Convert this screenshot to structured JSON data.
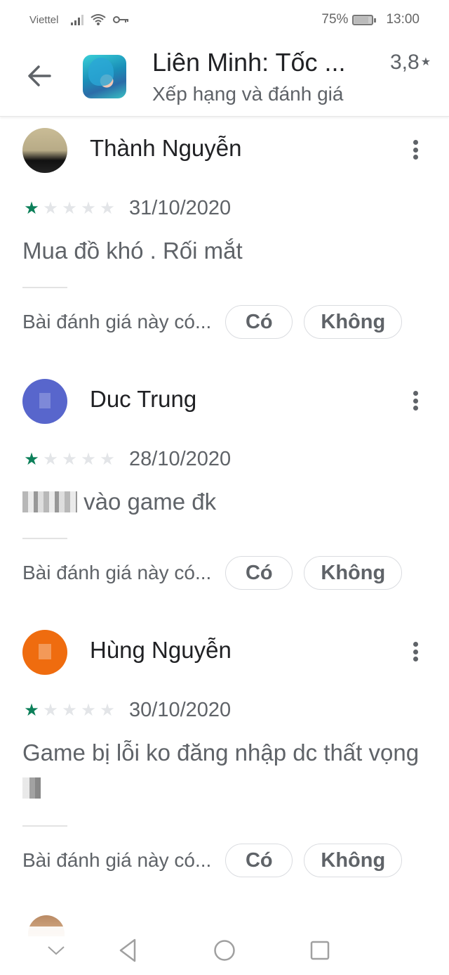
{
  "status_bar": {
    "carrier": "Viettel",
    "battery_percent": "75%",
    "battery_level": 0.75,
    "time": "13:00",
    "icons": [
      "signal-icon",
      "wifi-icon",
      "vpn-key-icon",
      "battery-saver-icon"
    ]
  },
  "app_bar": {
    "back_icon": "arrow-left-icon",
    "app_icon": "app-icon-lien-minh",
    "title": "Liên Minh: Tốc ...",
    "subtitle": "Xếp hạng và đánh giá",
    "rating": "3,8",
    "rating_star": "★"
  },
  "reviews": [
    {
      "name": "Thành Nguyễn",
      "rating": 1,
      "max_rating": 5,
      "date": "31/10/2020",
      "text": "Mua đồ khó . Rối mắt",
      "helpful_label": "Bài đánh giá này có...",
      "yes_label": "Có",
      "no_label": "Không"
    },
    {
      "name": "Duc Trung",
      "rating": 1,
      "max_rating": 5,
      "date": "28/10/2020",
      "text_censored_prefix": true,
      "text": " vào game đk",
      "helpful_label": "Bài đánh giá này có...",
      "yes_label": "Có",
      "no_label": "Không"
    },
    {
      "name": "Hùng Nguyễn",
      "rating": 1,
      "max_rating": 5,
      "date": "30/10/2020",
      "text": "Game bị lỗi ko đăng nhập dc thất vọng ",
      "text_censored_suffix": true,
      "helpful_label": "Bài đánh giá này có...",
      "yes_label": "Có",
      "no_label": "Không"
    }
  ],
  "colors": {
    "star_active": "#0b7f59",
    "star_inactive": "#e3e5e8",
    "text_primary": "#202124",
    "text_secondary": "#5f6368"
  },
  "nav_bar": {
    "buttons": [
      "hide-nav-icon",
      "back-triangle-icon",
      "home-circle-icon",
      "recents-square-icon"
    ]
  }
}
